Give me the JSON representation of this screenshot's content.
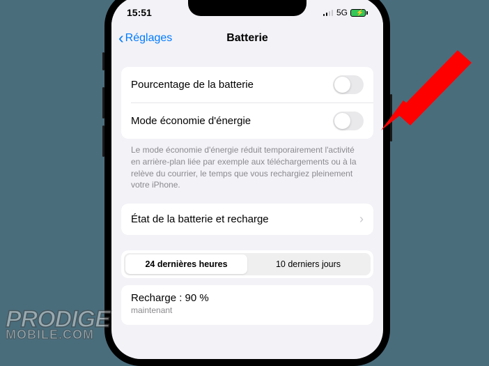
{
  "status": {
    "time": "15:51",
    "network": "5G"
  },
  "nav": {
    "back": "Réglages",
    "title": "Batterie"
  },
  "rows": {
    "percentage": "Pourcentage de la batterie",
    "lowpower": "Mode économie d'énergie"
  },
  "lowpower_footer": "Le mode économie d'énergie réduit temporairement l'activité en arrière-plan liée par exemple aux téléchargements ou à la relève du courrier, le temps que vous rechargiez pleinement votre iPhone.",
  "health_row": "État de la batterie et recharge",
  "segments": {
    "hours24": "24 dernières heures",
    "days10": "10 derniers jours"
  },
  "recharge": {
    "title": "Recharge : 90 %",
    "sub": "maintenant"
  },
  "watermark": {
    "line1": "PRODIGE",
    "line2": "MOBILE.COM"
  }
}
